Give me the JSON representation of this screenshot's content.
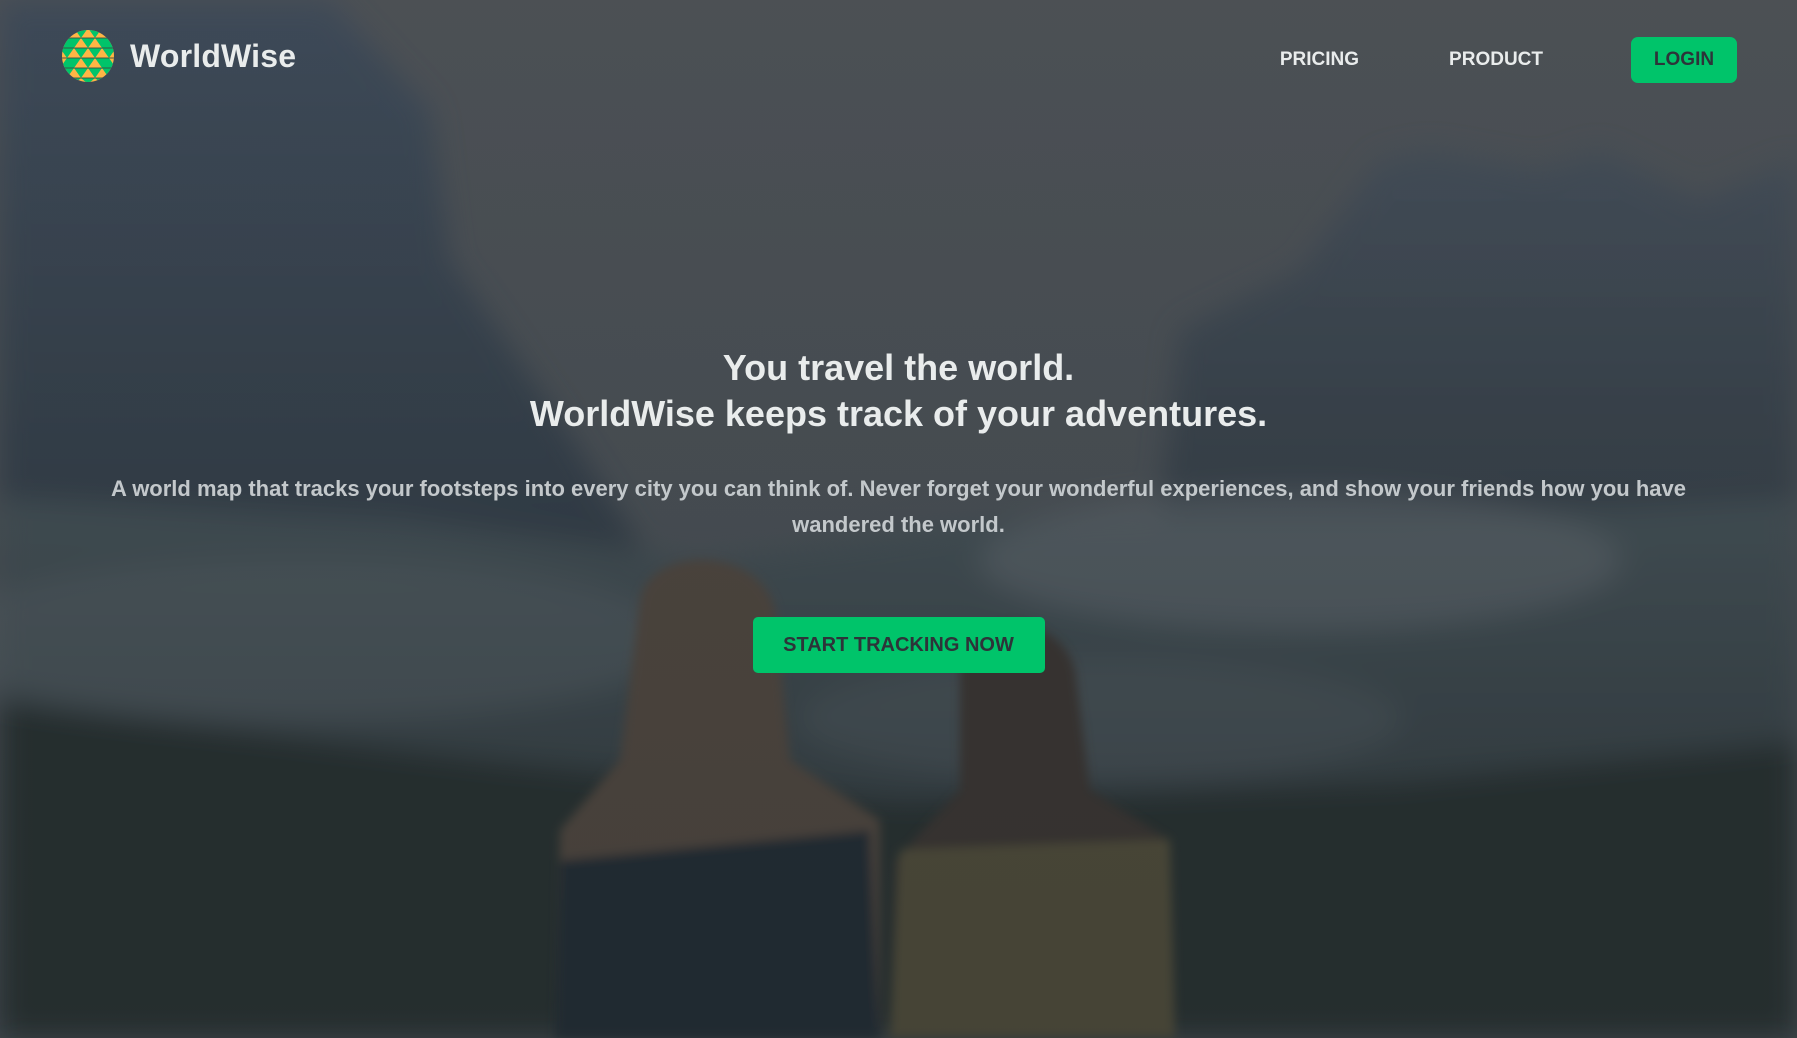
{
  "brand": {
    "name": "WorldWise",
    "logo_icon": "globe-icon",
    "accent_color": "#00c46a"
  },
  "nav": {
    "items": [
      {
        "label": "PRICING"
      },
      {
        "label": "PRODUCT"
      }
    ],
    "login_label": "LOGIN"
  },
  "hero": {
    "title_line_1": "You travel the world.",
    "title_line_2": "WorldWise keeps track of your adventures.",
    "description": "A world map that tracks your footsteps into every city you can think of. Never forget your wonderful experiences, and show your friends how you have wandered the world.",
    "cta_label": "START TRACKING NOW"
  }
}
